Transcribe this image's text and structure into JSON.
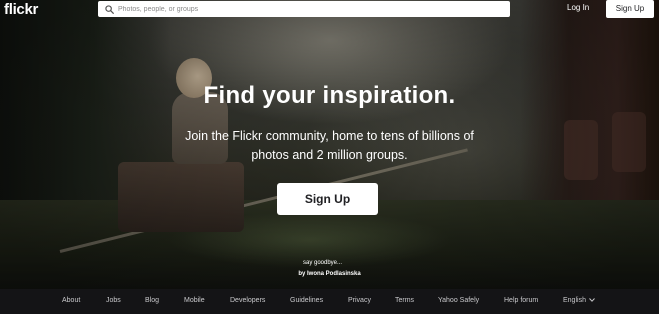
{
  "header": {
    "logo": "flickr",
    "search_placeholder": "Photos, people, or groups",
    "login_label": "Log In",
    "signup_label": "Sign Up"
  },
  "hero": {
    "headline": "Find your inspiration.",
    "subline_1": "Join the Flickr community, home to tens of billions of",
    "subline_2": "photos and 2 million groups.",
    "cta_label": "Sign Up",
    "photo_title": "say goodbye...",
    "photo_author": "by Iwona Podlasinska"
  },
  "footer": {
    "links": [
      "About",
      "Jobs",
      "Blog",
      "Mobile",
      "Developers",
      "Guidelines",
      "Privacy",
      "Terms",
      "Yahoo Safely",
      "Help forum"
    ],
    "language": "English"
  },
  "colors": {
    "button_bg": "#ffffff",
    "button_text": "#212124",
    "footer_bg": "#141416"
  }
}
